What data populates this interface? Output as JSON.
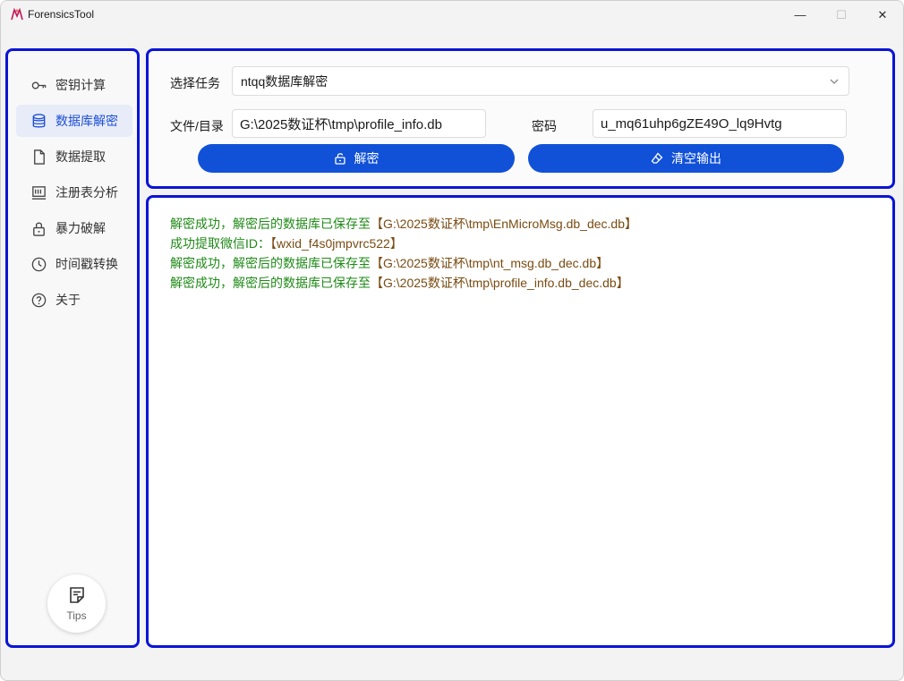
{
  "window": {
    "title": "ForensicsTool",
    "controls": {
      "minimize": "—",
      "maximize": "☐",
      "close": "✕"
    }
  },
  "sidebar": {
    "items": [
      {
        "label": "密钥计算",
        "icon": "key-icon",
        "active": false
      },
      {
        "label": "数据库解密",
        "icon": "database-icon",
        "active": true
      },
      {
        "label": "数据提取",
        "icon": "file-icon",
        "active": false
      },
      {
        "label": "注册表分析",
        "icon": "registry-icon",
        "active": false
      },
      {
        "label": "暴力破解",
        "icon": "lock-icon",
        "active": false
      },
      {
        "label": "时间戳转换",
        "icon": "clock-icon",
        "active": false
      },
      {
        "label": "关于",
        "icon": "help-icon",
        "active": false
      }
    ],
    "tips_label": "Tips"
  },
  "form": {
    "task_label": "选择任务",
    "task_value": "ntqq数据库解密",
    "path_label": "文件/目录",
    "path_value": "G:\\2025数证杯\\tmp\\profile_info.db",
    "password_label": "密码",
    "password_value": "u_mq61uhp6gZE49O_lq9Hvtg",
    "decrypt_button": "解密",
    "clear_button": "清空输出"
  },
  "output": {
    "lines": [
      {
        "message": "解密成功，解密后的数据库已保存至",
        "value": "【G:\\2025数证杯\\tmp\\EnMicroMsg.db_dec.db】"
      },
      {
        "message": "成功提取微信ID：",
        "value": "【wxid_f4s0jmpvrc522】"
      },
      {
        "message": "解密成功，解密后的数据库已保存至",
        "value": "【G:\\2025数证杯\\tmp\\nt_msg.db_dec.db】"
      },
      {
        "message": "解密成功，解密后的数据库已保存至",
        "value": "【G:\\2025数证杯\\tmp\\profile_info.db_dec.db】"
      }
    ]
  },
  "colors": {
    "accent": "#1151d8",
    "panel_border": "#0a14d6",
    "success_text": "#1f8a17",
    "path_text": "#7a4b12"
  }
}
